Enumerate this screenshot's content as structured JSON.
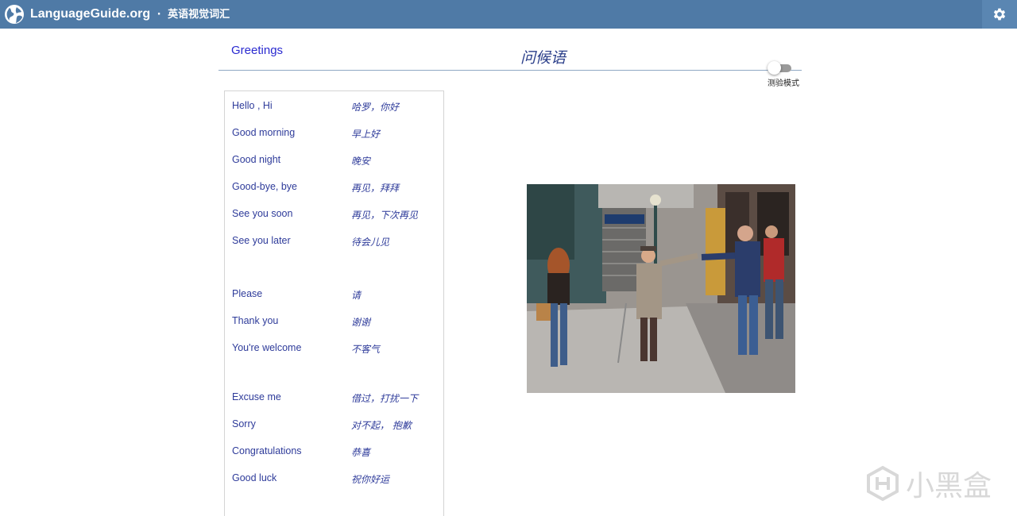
{
  "topbar": {
    "brand_name": "LanguageGuide.org",
    "brand_separator": " · ",
    "brand_subtitle": "英语视觉词汇"
  },
  "header": {
    "section_link": "Greetings",
    "title": "问候语",
    "quiz_toggle_label": "测验模式",
    "quiz_mode_on": false
  },
  "vocab": {
    "items": [
      {
        "en": "Hello , Hi",
        "zh": "哈罗，你好"
      },
      {
        "en": "Good morning",
        "zh": "早上好"
      },
      {
        "en": "Good night",
        "zh": "晚安"
      },
      {
        "en": "Good-bye, bye",
        "zh": "再见，拜拜"
      },
      {
        "en": "See you soon",
        "zh": "再见，下次再见"
      },
      {
        "en": "See you later",
        "zh": "待会儿见"
      },
      {
        "en": "Please",
        "zh": "请"
      },
      {
        "en": "Thank you",
        "zh": "谢谢"
      },
      {
        "en": "You're welcome",
        "zh": "不客气"
      },
      {
        "en": "Excuse me",
        "zh": "借过，打扰一下"
      },
      {
        "en": "Sorry",
        "zh": "对不起， 抱歉"
      },
      {
        "en": "Congratulations",
        "zh": "恭喜"
      },
      {
        "en": "Good luck",
        "zh": "祝你好运"
      }
    ]
  },
  "icons": {
    "logo": "globe-icon",
    "settings": "gear-icon"
  },
  "watermark": {
    "text": "小黑盒"
  },
  "colors": {
    "topbar": "#4f7aa6",
    "link": "#2a2ad0",
    "text": "#2e3b9a"
  }
}
